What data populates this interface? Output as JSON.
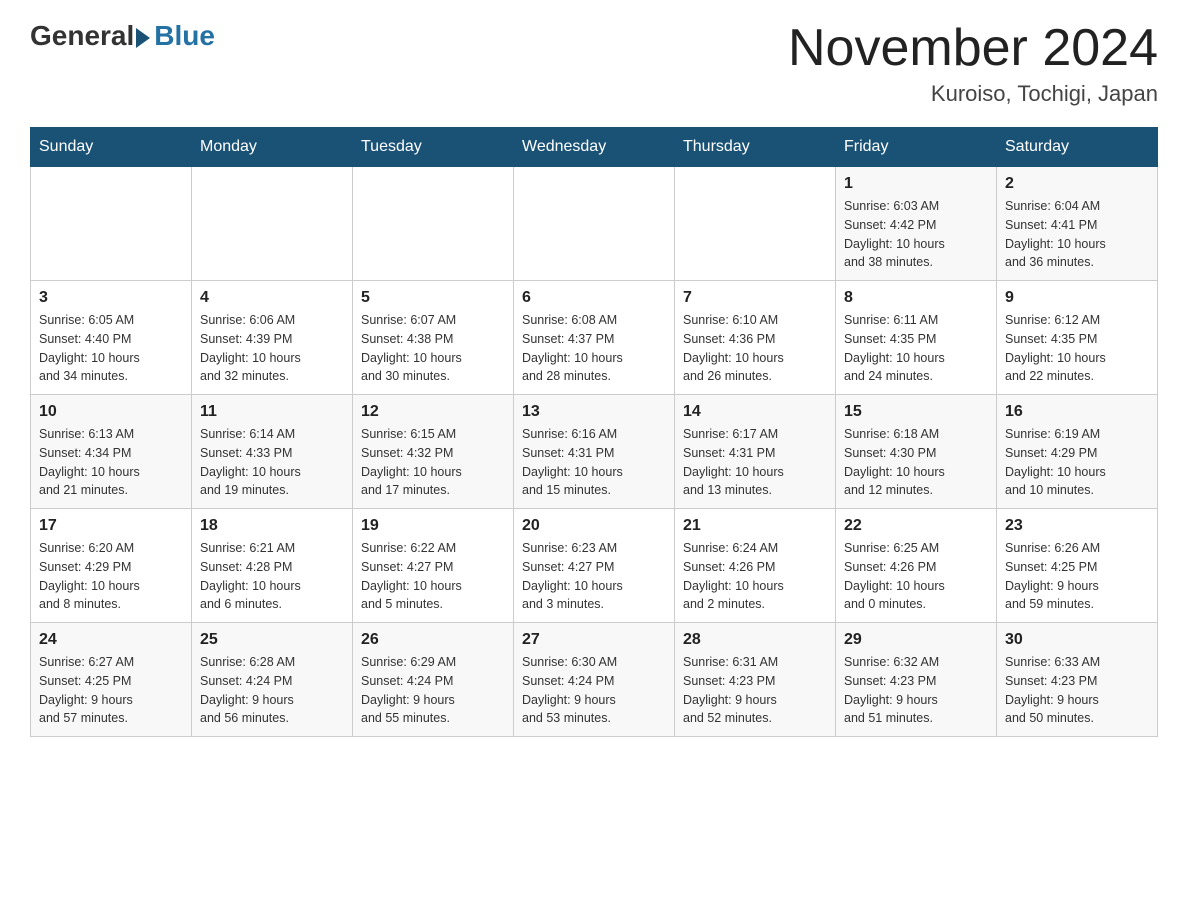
{
  "header": {
    "logo_general": "General",
    "logo_blue": "Blue",
    "month_title": "November 2024",
    "location": "Kuroiso, Tochigi, Japan"
  },
  "days_of_week": [
    "Sunday",
    "Monday",
    "Tuesday",
    "Wednesday",
    "Thursday",
    "Friday",
    "Saturday"
  ],
  "weeks": [
    [
      {
        "day": "",
        "info": ""
      },
      {
        "day": "",
        "info": ""
      },
      {
        "day": "",
        "info": ""
      },
      {
        "day": "",
        "info": ""
      },
      {
        "day": "",
        "info": ""
      },
      {
        "day": "1",
        "info": "Sunrise: 6:03 AM\nSunset: 4:42 PM\nDaylight: 10 hours\nand 38 minutes."
      },
      {
        "day": "2",
        "info": "Sunrise: 6:04 AM\nSunset: 4:41 PM\nDaylight: 10 hours\nand 36 minutes."
      }
    ],
    [
      {
        "day": "3",
        "info": "Sunrise: 6:05 AM\nSunset: 4:40 PM\nDaylight: 10 hours\nand 34 minutes."
      },
      {
        "day": "4",
        "info": "Sunrise: 6:06 AM\nSunset: 4:39 PM\nDaylight: 10 hours\nand 32 minutes."
      },
      {
        "day": "5",
        "info": "Sunrise: 6:07 AM\nSunset: 4:38 PM\nDaylight: 10 hours\nand 30 minutes."
      },
      {
        "day": "6",
        "info": "Sunrise: 6:08 AM\nSunset: 4:37 PM\nDaylight: 10 hours\nand 28 minutes."
      },
      {
        "day": "7",
        "info": "Sunrise: 6:10 AM\nSunset: 4:36 PM\nDaylight: 10 hours\nand 26 minutes."
      },
      {
        "day": "8",
        "info": "Sunrise: 6:11 AM\nSunset: 4:35 PM\nDaylight: 10 hours\nand 24 minutes."
      },
      {
        "day": "9",
        "info": "Sunrise: 6:12 AM\nSunset: 4:35 PM\nDaylight: 10 hours\nand 22 minutes."
      }
    ],
    [
      {
        "day": "10",
        "info": "Sunrise: 6:13 AM\nSunset: 4:34 PM\nDaylight: 10 hours\nand 21 minutes."
      },
      {
        "day": "11",
        "info": "Sunrise: 6:14 AM\nSunset: 4:33 PM\nDaylight: 10 hours\nand 19 minutes."
      },
      {
        "day": "12",
        "info": "Sunrise: 6:15 AM\nSunset: 4:32 PM\nDaylight: 10 hours\nand 17 minutes."
      },
      {
        "day": "13",
        "info": "Sunrise: 6:16 AM\nSunset: 4:31 PM\nDaylight: 10 hours\nand 15 minutes."
      },
      {
        "day": "14",
        "info": "Sunrise: 6:17 AM\nSunset: 4:31 PM\nDaylight: 10 hours\nand 13 minutes."
      },
      {
        "day": "15",
        "info": "Sunrise: 6:18 AM\nSunset: 4:30 PM\nDaylight: 10 hours\nand 12 minutes."
      },
      {
        "day": "16",
        "info": "Sunrise: 6:19 AM\nSunset: 4:29 PM\nDaylight: 10 hours\nand 10 minutes."
      }
    ],
    [
      {
        "day": "17",
        "info": "Sunrise: 6:20 AM\nSunset: 4:29 PM\nDaylight: 10 hours\nand 8 minutes."
      },
      {
        "day": "18",
        "info": "Sunrise: 6:21 AM\nSunset: 4:28 PM\nDaylight: 10 hours\nand 6 minutes."
      },
      {
        "day": "19",
        "info": "Sunrise: 6:22 AM\nSunset: 4:27 PM\nDaylight: 10 hours\nand 5 minutes."
      },
      {
        "day": "20",
        "info": "Sunrise: 6:23 AM\nSunset: 4:27 PM\nDaylight: 10 hours\nand 3 minutes."
      },
      {
        "day": "21",
        "info": "Sunrise: 6:24 AM\nSunset: 4:26 PM\nDaylight: 10 hours\nand 2 minutes."
      },
      {
        "day": "22",
        "info": "Sunrise: 6:25 AM\nSunset: 4:26 PM\nDaylight: 10 hours\nand 0 minutes."
      },
      {
        "day": "23",
        "info": "Sunrise: 6:26 AM\nSunset: 4:25 PM\nDaylight: 9 hours\nand 59 minutes."
      }
    ],
    [
      {
        "day": "24",
        "info": "Sunrise: 6:27 AM\nSunset: 4:25 PM\nDaylight: 9 hours\nand 57 minutes."
      },
      {
        "day": "25",
        "info": "Sunrise: 6:28 AM\nSunset: 4:24 PM\nDaylight: 9 hours\nand 56 minutes."
      },
      {
        "day": "26",
        "info": "Sunrise: 6:29 AM\nSunset: 4:24 PM\nDaylight: 9 hours\nand 55 minutes."
      },
      {
        "day": "27",
        "info": "Sunrise: 6:30 AM\nSunset: 4:24 PM\nDaylight: 9 hours\nand 53 minutes."
      },
      {
        "day": "28",
        "info": "Sunrise: 6:31 AM\nSunset: 4:23 PM\nDaylight: 9 hours\nand 52 minutes."
      },
      {
        "day": "29",
        "info": "Sunrise: 6:32 AM\nSunset: 4:23 PM\nDaylight: 9 hours\nand 51 minutes."
      },
      {
        "day": "30",
        "info": "Sunrise: 6:33 AM\nSunset: 4:23 PM\nDaylight: 9 hours\nand 50 minutes."
      }
    ]
  ]
}
